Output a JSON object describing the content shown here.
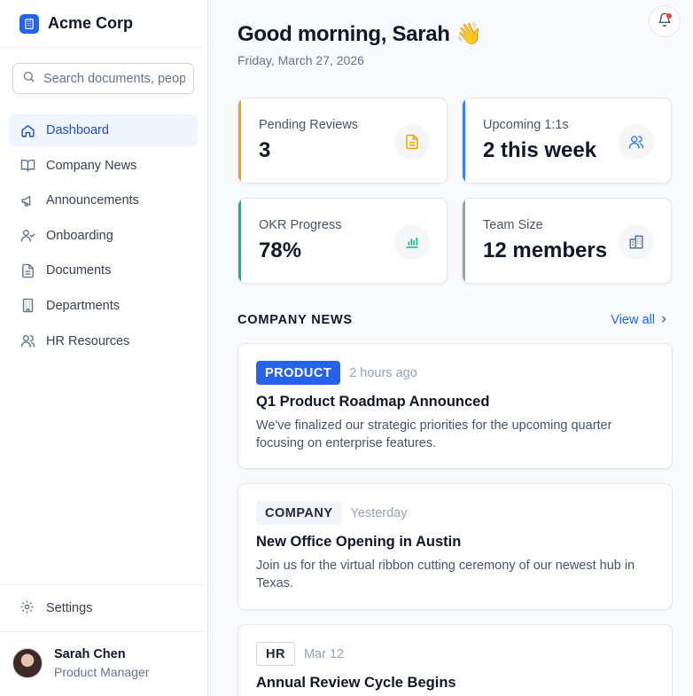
{
  "app": {
    "name": "Acme Corp"
  },
  "search": {
    "placeholder": "Search documents, people..."
  },
  "sidebar": {
    "items": [
      {
        "label": "Dashboard",
        "icon": "home-icon",
        "active": true
      },
      {
        "label": "Company News",
        "icon": "book-open-icon"
      },
      {
        "label": "Announcements",
        "icon": "megaphone-icon"
      },
      {
        "label": "Onboarding",
        "icon": "user-check-icon"
      },
      {
        "label": "Documents",
        "icon": "file-text-icon"
      },
      {
        "label": "Departments",
        "icon": "building-icon"
      },
      {
        "label": "HR Resources",
        "icon": "users-icon"
      }
    ],
    "settings_label": "Settings"
  },
  "user": {
    "name": "Sarah Chen",
    "role": "Product Manager"
  },
  "header": {
    "greeting": "Good morning, Sarah 👋",
    "date": "Friday, March 27, 2026"
  },
  "stats": [
    {
      "label": "Pending Reviews",
      "value": "3",
      "accent": "#f59e0b",
      "icon": "file-text-icon"
    },
    {
      "label": "Upcoming 1:1s",
      "value": "2 this week",
      "accent": "#3b82f6",
      "icon": "users-icon"
    },
    {
      "label": "OKR Progress",
      "value": "78%",
      "accent": "#10b981",
      "icon": "bar-chart-icon"
    },
    {
      "label": "Team Size",
      "value": "12 members",
      "accent": "#94a3b8",
      "icon": "building-icon"
    }
  ],
  "news": {
    "heading": "COMPANY NEWS",
    "view_all": "View all",
    "items": [
      {
        "tag": "PRODUCT",
        "time": "2 hours ago",
        "title": "Q1 Product Roadmap Announced",
        "body": "We've finalized our strategic priorities for the upcoming quarter focusing on enterprise features."
      },
      {
        "tag": "COMPANY",
        "time": "Yesterday",
        "title": "New Office Opening in Austin",
        "body": "Join us for the virtual ribbon cutting ceremony of our newest hub in Texas."
      },
      {
        "tag": "HR",
        "time": "Mar 12",
        "title": "Annual Review Cycle Begins",
        "body": ""
      }
    ]
  },
  "colors": {
    "primary": "#2563eb",
    "notification": "#ef4444"
  }
}
